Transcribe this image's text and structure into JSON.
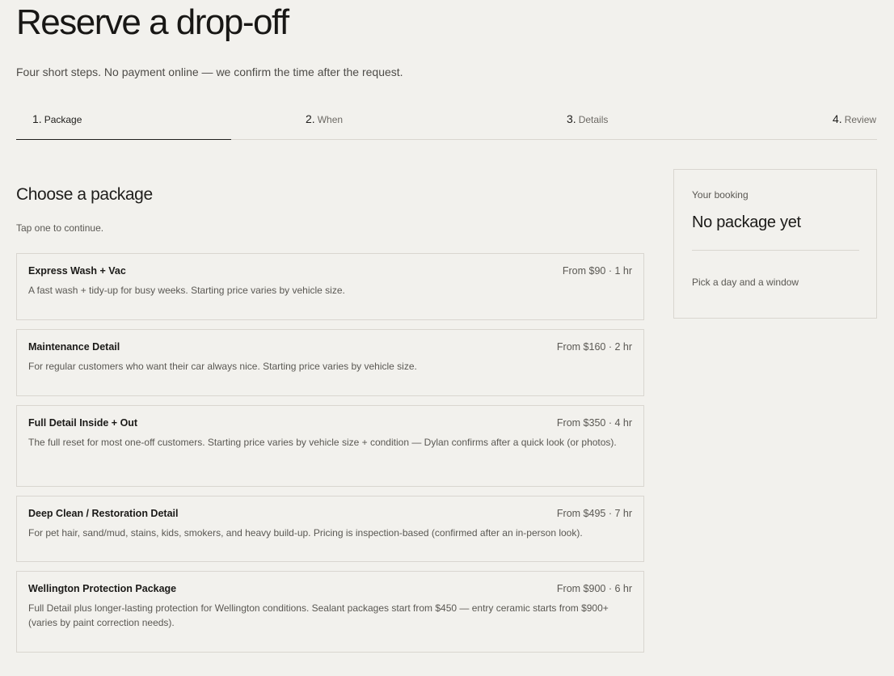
{
  "page": {
    "title": "Reserve a drop-off",
    "subtitle": "Four short steps. No payment online — we confirm the time after the request."
  },
  "steps": [
    {
      "number": "1.",
      "label": "Package",
      "active": true
    },
    {
      "number": "2.",
      "label": "When",
      "active": false
    },
    {
      "number": "3.",
      "label": "Details",
      "active": false
    },
    {
      "number": "4.",
      "label": "Review",
      "active": false
    }
  ],
  "section": {
    "title": "Choose a package",
    "hint": "Tap one to continue."
  },
  "packages": [
    {
      "name": "Express Wash + Vac",
      "price": "From $90 · 1 hr",
      "description": "A fast wash + tidy-up for busy weeks. Starting price varies by vehicle size."
    },
    {
      "name": "Maintenance Detail",
      "price": "From $160 · 2 hr",
      "description": "For regular customers who want their car always nice. Starting price varies by vehicle size."
    },
    {
      "name": "Full Detail Inside + Out",
      "price": "From $350 · 4 hr",
      "description": "The full reset for most one-off customers. Starting price varies by vehicle size + condition — Dylan confirms after a quick look (or photos)."
    },
    {
      "name": "Deep Clean / Restoration Detail",
      "price": "From $495 · 7 hr",
      "description": "For pet hair, sand/mud, stains, kids, smokers, and heavy build-up. Pricing is inspection-based (confirmed after an in-person look)."
    },
    {
      "name": "Wellington Protection Package",
      "price": "From $900 · 6 hr",
      "description": "Full Detail plus longer-lasting protection for Wellington conditions. Sealant packages start from $450 — entry ceramic starts from $900+ (varies by paint correction needs)."
    }
  ],
  "summary": {
    "label": "Your booking",
    "value": "No package yet",
    "note": "Pick a day and a window"
  }
}
